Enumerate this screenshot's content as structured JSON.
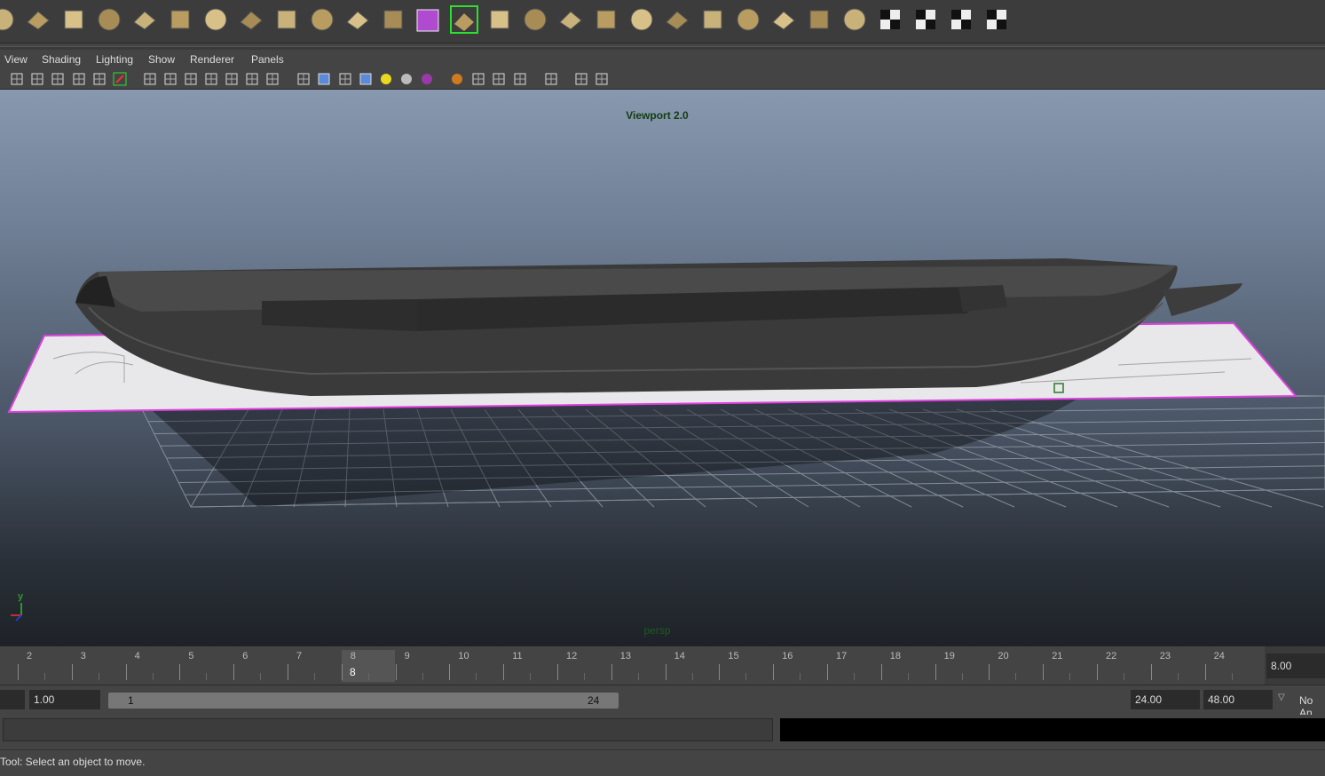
{
  "shelf": {
    "icons": [
      "sphere-icon",
      "cube-icon",
      "cylinder-icon",
      "cone-icon",
      "plane-icon",
      "torus-icon",
      "pyramid-icon",
      "pipe-icon",
      "soccer-ball-icon",
      "bridge-icon",
      "sphere-wire-icon",
      "sphere-wire-icon-2",
      "selected-cube-icon",
      "uv-tool-icon",
      "move-tool-icon",
      "extrude-icon",
      "split-icon",
      "bevel-icon",
      "bridge-face-icon",
      "merge-icon",
      "crease-icon",
      "cut-icon",
      "insert-loop-icon",
      "sculpt-icon",
      "checker-uv-icon",
      "checker-uv-2-icon",
      "checker-uv-3-icon",
      "checker-sphere-icon",
      "checker-texture-icon"
    ]
  },
  "menu": {
    "view": "View",
    "shading": "Shading",
    "lighting": "Lighting",
    "show": "Show",
    "renderer": "Renderer",
    "panels": "Panels"
  },
  "viewport": {
    "title": "Viewport 2.0",
    "camera": "persp",
    "axis_y": "y"
  },
  "timeline": {
    "ticks": [
      "2",
      "3",
      "4",
      "5",
      "6",
      "7",
      "8",
      "9",
      "10",
      "11",
      "12",
      "13",
      "14",
      "15",
      "16",
      "17",
      "18",
      "19",
      "20",
      "21",
      "22",
      "23",
      "24"
    ],
    "current_frame_marker": "8",
    "current_frame_value": "8.00"
  },
  "range": {
    "start_time": "1.00",
    "slider_start": "1",
    "slider_end": "24",
    "end_time": "24.00",
    "anim_end": "48.00",
    "anim_layer": "No An"
  },
  "help": {
    "text": "Tool: Select an object to move."
  },
  "colors": {
    "selection": "#e040e0",
    "viewport_top": "#8898ae",
    "viewport_bottom": "#1e2228"
  }
}
